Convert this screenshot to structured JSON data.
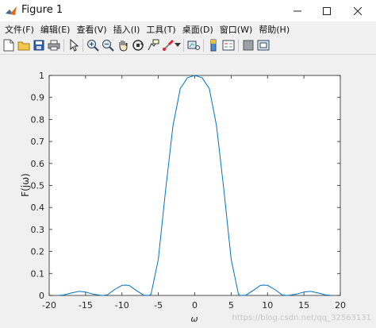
{
  "window": {
    "title": "Figure 1"
  },
  "menu": [
    "文件(F)",
    "编辑(E)",
    "查看(V)",
    "插入(I)",
    "工具(T)",
    "桌面(D)",
    "窗口(W)",
    "帮助(H)"
  ],
  "toolbar": {
    "icons": [
      "new-figure-icon",
      "open-file-icon",
      "save-icon",
      "print-icon",
      "pointer-icon",
      "zoom-in-icon",
      "zoom-out-icon",
      "pan-hand-icon",
      "rotate-3d-icon",
      "data-cursor-icon",
      "brush-icon",
      "brush-dropdown-icon",
      "link-plot-icon",
      "colorbar-icon",
      "legend-icon",
      "hide-plot-tools-icon",
      "show-plot-tools-icon"
    ]
  },
  "watermark": "https://blog.csdn.net/qq_32563131",
  "chart_data": {
    "type": "line",
    "title": "",
    "xlabel": "ω",
    "ylabel": "F(jω)",
    "xlim": [
      -20,
      20
    ],
    "ylim": [
      0,
      1
    ],
    "xticks": [
      "-20",
      "-15",
      "-10",
      "-5",
      "0",
      "5",
      "10",
      "15",
      "20"
    ],
    "yticks": [
      "0",
      "0.1",
      "0.2",
      "0.3",
      "0.4",
      "0.5",
      "0.6",
      "0.7",
      "0.8",
      "0.9",
      "1"
    ],
    "grid": false,
    "series": [
      {
        "color": "#0072bd",
        "x": [
          -18.85,
          -18,
          -17,
          -16,
          -15.71,
          -15,
          -14,
          -13,
          -12.57,
          -12,
          -11,
          -10,
          -9.42,
          -9,
          -8,
          -7,
          -6.28,
          -6,
          -5,
          -4,
          -3,
          -2,
          -1,
          0,
          1,
          2,
          3,
          4,
          5,
          6,
          6.28,
          7,
          8,
          9,
          9.42,
          10,
          11,
          12,
          12.57,
          13,
          14,
          15,
          15.71,
          16,
          17,
          18,
          18.85
        ],
        "y": [
          0,
          0.002,
          0.011,
          0.018,
          0.018,
          0.015,
          0.006,
          0.001,
          0,
          0.003,
          0.027,
          0.046,
          0.047,
          0.045,
          0.022,
          0.001,
          0,
          0.005,
          0.165,
          0.48,
          0.77,
          0.94,
          0.99,
          1,
          0.99,
          0.94,
          0.77,
          0.48,
          0.165,
          0.005,
          0,
          0.001,
          0.022,
          0.045,
          0.047,
          0.046,
          0.027,
          0.003,
          0,
          0.001,
          0.006,
          0.015,
          0.018,
          0.018,
          0.011,
          0.002,
          0
        ]
      }
    ]
  }
}
